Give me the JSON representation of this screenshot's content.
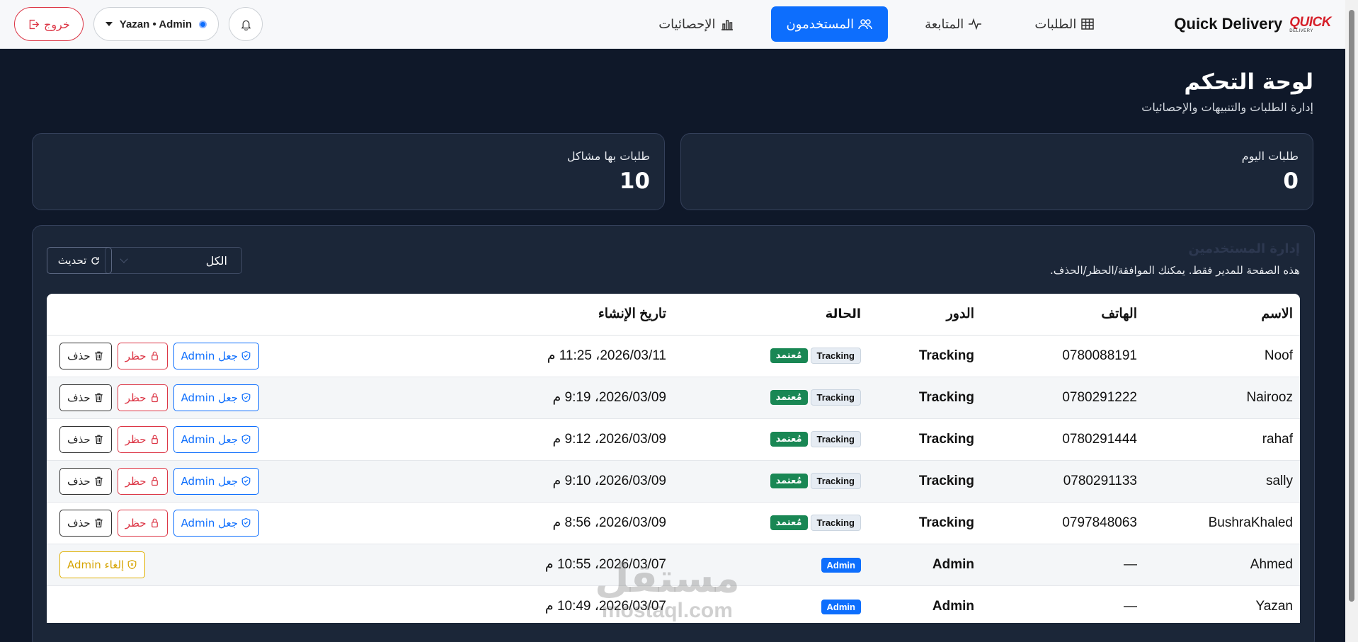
{
  "navbar": {
    "logo_top": "QUICK",
    "logo_bottom": "DELIVERY",
    "brand": "Quick Delivery",
    "links": [
      {
        "label": "الطلبات",
        "icon": "table-icon"
      },
      {
        "label": "المتابعة",
        "icon": "activity-icon"
      },
      {
        "label": "المستخدمون",
        "icon": "people-icon",
        "active": true
      },
      {
        "label": "الإحصائيات",
        "icon": "bar-chart-icon"
      }
    ],
    "user_label": "Yazan • Admin",
    "logout_label": "خروج"
  },
  "header": {
    "title": "لوحة التحكم",
    "subtitle": "إدارة الطلبات والتنبيهات والإحصائيات"
  },
  "stats": [
    {
      "label": "طلبات اليوم",
      "value": "0"
    },
    {
      "label": "طلبات بها مشاكل",
      "value": "10"
    }
  ],
  "users_panel": {
    "title": "إدارة المستخدمين",
    "subtitle": "هذه الصفحة للمدير فقط. يمكنك الموافقة/الحظر/الحذف.",
    "filter_value": "الكل",
    "refresh_label": "تحديث",
    "columns": {
      "name": "الاسم",
      "phone": "الهاتف",
      "role": "الدور",
      "status": "الحالة",
      "created": "تاريخ الإنشاء"
    },
    "action_labels": {
      "make_admin": "جعل Admin",
      "ban": "حظر",
      "delete": "حذف",
      "revoke_admin": "إلغاء Admin"
    },
    "approved_label": "مُعتمد",
    "rows": [
      {
        "name": "Noof",
        "phone": "0780088191",
        "role": "Tracking",
        "badge": "Tracking",
        "created": "2026/03/11، 11:25 م"
      },
      {
        "name": "Nairooz",
        "phone": "0780291222",
        "role": "Tracking",
        "badge": "Tracking",
        "created": "2026/03/09، 9:19 م"
      },
      {
        "name": "rahaf",
        "phone": "0780291444",
        "role": "Tracking",
        "badge": "Tracking",
        "created": "2026/03/09، 9:12 م"
      },
      {
        "name": "sally",
        "phone": "0780291133",
        "role": "Tracking",
        "badge": "Tracking",
        "created": "2026/03/09، 9:10 م"
      },
      {
        "name": "BushraKhaled",
        "phone": "0797848063",
        "role": "Tracking",
        "badge": "Tracking",
        "created": "2026/03/09، 8:56 م"
      },
      {
        "name": "Ahmed",
        "phone": "—",
        "role": "Admin",
        "badge": "Admin",
        "created": "2026/03/07، 10:55 م"
      },
      {
        "name": "Yazan",
        "phone": "—",
        "role": "Admin",
        "badge": "Admin",
        "created": "2026/03/07، 10:49 م"
      }
    ]
  },
  "watermark": {
    "arabic": "مستقل",
    "latin": "mostaql.com"
  },
  "colors": {
    "primary": "#0d6efd",
    "danger": "#dc3545",
    "success": "#198754",
    "warning": "#e0b000",
    "bg": "#0f1829",
    "card": "#1b2638"
  }
}
